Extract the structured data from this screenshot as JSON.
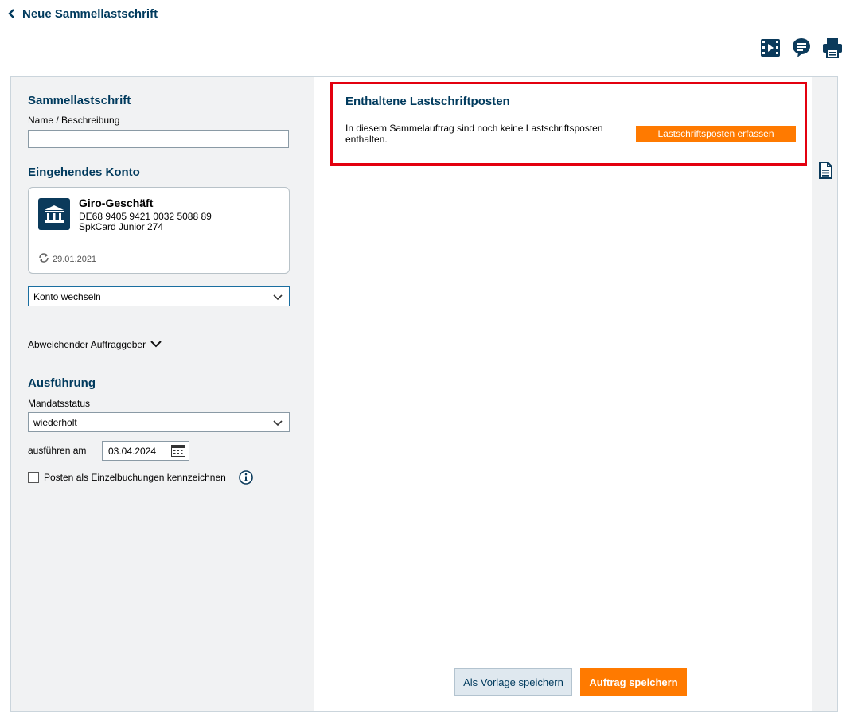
{
  "header": {
    "title": "Neue Sammellastschrift"
  },
  "toolbar": {
    "icons": [
      "video-icon",
      "chat-icon",
      "print-icon"
    ]
  },
  "form": {
    "section_title": "Sammellastschrift",
    "name_label": "Name / Beschreibung",
    "name_value": "",
    "account_section_title": "Eingehendes Konto",
    "account": {
      "name": "Giro-Geschäft",
      "iban": "DE68 9405 9421 0032 5088 89",
      "card": "SpkCard Junior 274",
      "updated": "29.01.2021"
    },
    "change_account_select": "Konto wechseln",
    "other_payer_label": "Abweichender Auftraggeber",
    "execution_title": "Ausführung",
    "mandate_label": "Mandatsstatus",
    "mandate_value": "wiederholt",
    "execute_on_label": "ausführen am",
    "execute_on_value": "03.04.2024",
    "single_booking_label": "Posten als Einzelbuchungen kennzeichnen",
    "single_booking_checked": false
  },
  "content": {
    "title": "Enthaltene Lastschriftposten",
    "empty_message": "In diesem Sammelauftrag sind noch keine Lastschriftsposten enthalten.",
    "add_button": "Lastschriftsposten erfassen"
  },
  "footer": {
    "save_template": "Als Vorlage speichern",
    "save_order": "Auftrag speichern"
  },
  "colors": {
    "brand_blue": "#003a5d",
    "accent_orange": "#ff7a00",
    "highlight_red": "#e3000f"
  }
}
